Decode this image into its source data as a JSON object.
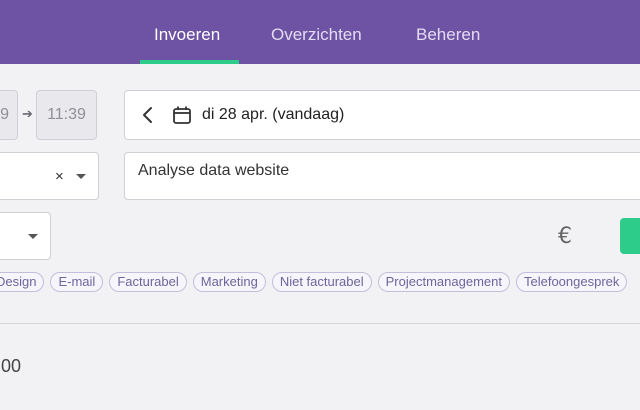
{
  "nav": {
    "tabs": [
      {
        "label": "Invoeren",
        "active": true
      },
      {
        "label": "Overzichten",
        "active": false
      },
      {
        "label": "Beheren",
        "active": false
      }
    ]
  },
  "time": {
    "start_partial": "9",
    "end": "11:39"
  },
  "date": {
    "value": "di 28 apr. (vandaag)"
  },
  "description": {
    "value": "Analyse data website"
  },
  "currency_symbol": "€",
  "tags": [
    "Design",
    "E-mail",
    "Facturabel",
    "Marketing",
    "Niet facturabel",
    "Projectmanagement",
    "Telefoongesprek"
  ],
  "total": {
    "partial": ",00"
  },
  "colors": {
    "nav_bg": "#6e52a3",
    "accent_green": "#2ecc8a",
    "tag_text": "#6d669c"
  }
}
